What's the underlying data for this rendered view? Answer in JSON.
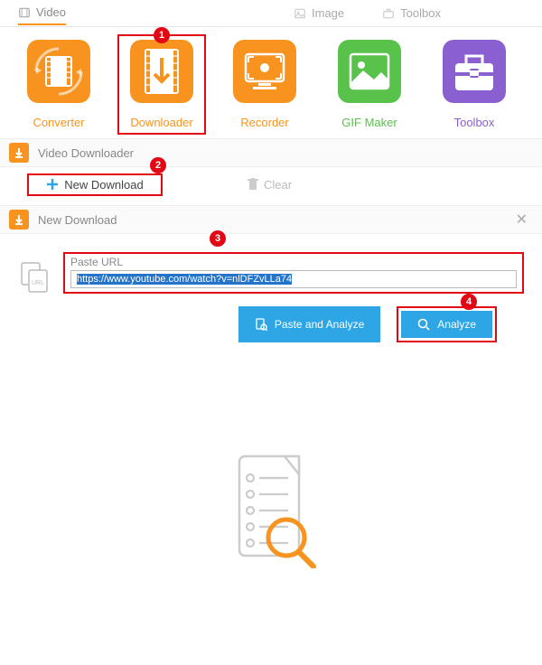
{
  "tabs": {
    "video": "Video",
    "image": "Image",
    "toolbox": "Toolbox"
  },
  "tiles": {
    "converter": "Converter",
    "downloader": "Downloader",
    "recorder": "Recorder",
    "gif": "GIF Maker",
    "toolbox": "Toolbox"
  },
  "section": {
    "title": "Video Downloader"
  },
  "toolbar": {
    "new": "New Download",
    "clear": "Clear"
  },
  "panel": {
    "title": "New Download",
    "url_label": "Paste URL",
    "url_value": "https://www.youtube.com/watch?v=nlDFZvLLa74",
    "paste_analyze": "Paste and Analyze",
    "analyze": "Analyze"
  },
  "callouts": {
    "c1": "1",
    "c2": "2",
    "c3": "3",
    "c4": "4"
  }
}
